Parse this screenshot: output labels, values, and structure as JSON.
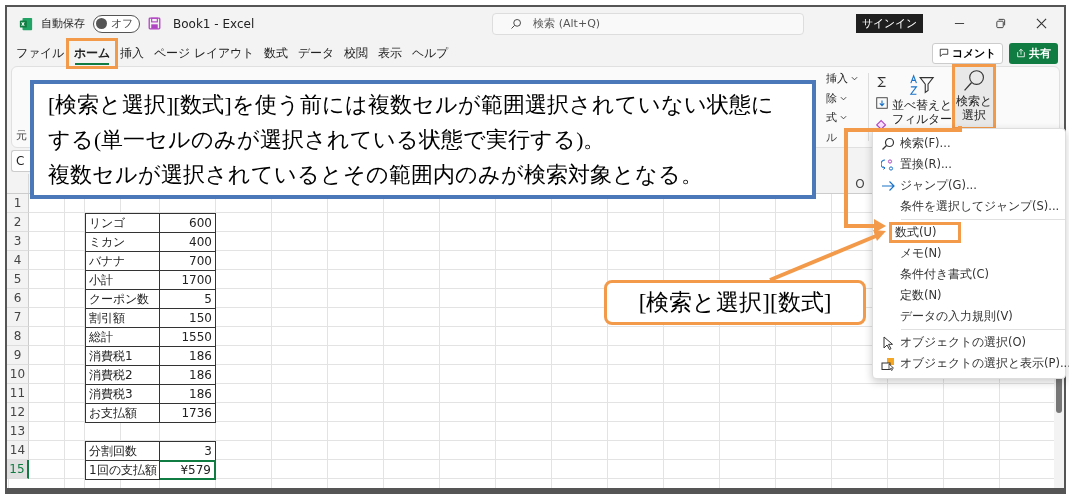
{
  "window": {
    "autosave_label": "自動保存",
    "autosave_toggle": {
      "label": "オフ",
      "on": false
    },
    "title": "Book1  -  Excel",
    "search": {
      "placeholder": "検索 (Alt+Q)"
    },
    "signin_button": "サインイン"
  },
  "ribbon_tabs": [
    {
      "label": "ファイル",
      "selected": false,
      "highlighted": false
    },
    {
      "label": "ホーム",
      "selected": true,
      "highlighted": true
    },
    {
      "label": "挿入",
      "selected": false,
      "highlighted": false
    },
    {
      "label": "ページ レイアウト",
      "selected": false,
      "highlighted": false
    },
    {
      "label": "数式",
      "selected": false,
      "highlighted": false
    },
    {
      "label": "データ",
      "selected": false,
      "highlighted": false
    },
    {
      "label": "校閲",
      "selected": false,
      "highlighted": false
    },
    {
      "label": "表示",
      "selected": false,
      "highlighted": false
    },
    {
      "label": "ヘルプ",
      "selected": false,
      "highlighted": false
    }
  ],
  "comment_button": "コメント",
  "share_button": "共有",
  "ribbon": {
    "left_group_label": "元",
    "cells_items": [
      "挿入",
      "除",
      "式"
    ],
    "cells_group_label": "ル",
    "sort_filter_button": [
      "並べ替えと",
      "フィルター"
    ],
    "find_select_button": {
      "lines": [
        "検索と",
        "選択"
      ],
      "highlighted": true
    }
  },
  "name_box": "C",
  "column_header": "O",
  "sheet": {
    "rows": [
      {
        "number": "1",
        "selected": false
      },
      {
        "number": "2",
        "label": "リンゴ",
        "value": "600",
        "selected": false
      },
      {
        "number": "3",
        "label": "ミカン",
        "value": "400",
        "selected": false
      },
      {
        "number": "4",
        "label": "バナナ",
        "value": "700",
        "selected": false
      },
      {
        "number": "5",
        "label": "小計",
        "value": "1700",
        "selected": false
      },
      {
        "number": "6",
        "label": "クーポン数",
        "value": "5",
        "selected": false
      },
      {
        "number": "7",
        "label": "割引額",
        "value": "150",
        "selected": false
      },
      {
        "number": "8",
        "label": "総計",
        "value": "1550",
        "selected": false
      },
      {
        "number": "9",
        "label": "消費税1",
        "value": "186",
        "selected": false
      },
      {
        "number": "10",
        "label": "消費税2",
        "value": "186",
        "selected": false
      },
      {
        "number": "11",
        "label": "消費税3",
        "value": "186",
        "selected": false
      },
      {
        "number": "12",
        "label": "お支払額",
        "value": "1736",
        "selected": false
      },
      {
        "number": "13",
        "selected": false
      },
      {
        "number": "14",
        "label": "分割回数",
        "value": "3",
        "selected": false
      },
      {
        "number": "15",
        "label": "1回の支払額",
        "value": "¥579",
        "selected": true
      }
    ]
  },
  "menu": {
    "groups": [
      [
        {
          "label": "検索(F)...",
          "kind": "search",
          "highlighted": false
        },
        {
          "label": "置換(R)...",
          "kind": "replace",
          "highlighted": false
        },
        {
          "label": "ジャンプ(G)...",
          "kind": "goto",
          "highlighted": false
        },
        {
          "label": "条件を選択してジャンプ(S)...",
          "kind": "plain",
          "highlighted": false
        }
      ],
      [
        {
          "label": "数式(U)",
          "kind": "plain",
          "highlighted": true
        },
        {
          "label": "メモ(N)",
          "kind": "plain",
          "highlighted": false
        },
        {
          "label": "条件付き書式(C)",
          "kind": "plain",
          "highlighted": false
        },
        {
          "label": "定数(N)",
          "kind": "plain",
          "highlighted": false
        },
        {
          "label": "データの入力規則(V)",
          "kind": "plain",
          "highlighted": false
        }
      ],
      [
        {
          "label": "オブジェクトの選択(O)",
          "kind": "pointer",
          "highlighted": false
        },
        {
          "label": "オブジェクトの選択と表示(P)...",
          "kind": "pane",
          "highlighted": false
        }
      ]
    ]
  },
  "callouts": [
    {
      "kind": "note",
      "paragraphs": [
        "[検索と選択][数式]を使う前には複数セルが範囲選択されていない状態にする(単一セルのみが選択されている状態で実行する)。",
        "複数セルが選択されているとその範囲内のみが検索対象となる。"
      ]
    },
    {
      "kind": "label",
      "paragraphs": [
        "[検索と選択][数式]"
      ]
    }
  ]
}
